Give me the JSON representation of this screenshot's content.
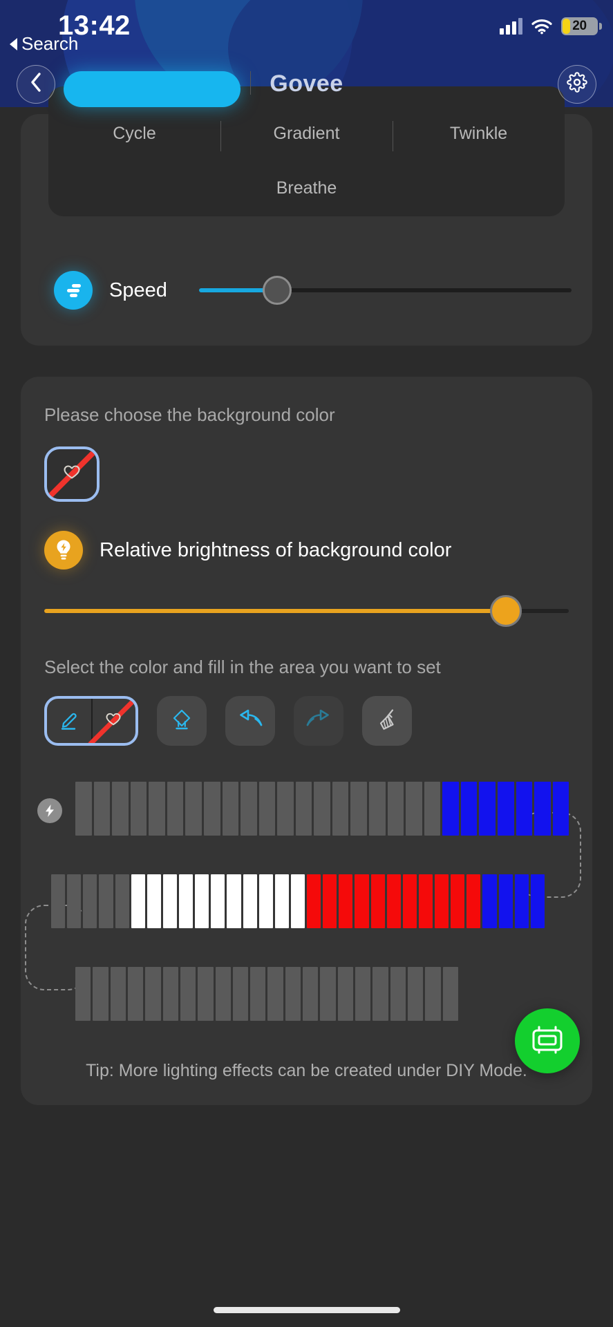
{
  "status_bar": {
    "time": "13:42",
    "back_app_label": "Search",
    "battery_percent": "20",
    "battery_level": 20,
    "signal_icon": "cellular-signal-icon",
    "wifi_icon": "wifi-icon",
    "battery_icon": "battery-icon"
  },
  "nav": {
    "back_icon": "chevron-left-icon",
    "brand_title": "Govee",
    "settings_icon": "gear-icon"
  },
  "modes": {
    "selected_index": 0,
    "items": [
      "Cycle",
      "Gradient",
      "Twinkle"
    ],
    "second_row": [
      "Breathe"
    ]
  },
  "speed": {
    "icon": "speed-icon",
    "label": "Speed",
    "value_percent": 21,
    "fill_color": "#17a8e0",
    "thumb_color": "#525252"
  },
  "background_section": {
    "choose_label": "Please choose the background color",
    "swatch": {
      "name": "no-color-swatch",
      "selected": true,
      "border_color": "#9bbdf0",
      "stripe_color": "#f0332c"
    },
    "brightness": {
      "icon": "bulb-icon",
      "label": "Relative brightness of background color",
      "value_percent": 88,
      "fill_color": "#e8a31f",
      "thumb_color": "#eda31c"
    },
    "select_label": "Select the color and fill in the area you want to set",
    "tools": [
      {
        "name": "pen-nocolor-tool",
        "icon": "pencil-icon",
        "secondary_icon": "no-color-icon",
        "selected": true,
        "enabled": true
      },
      {
        "name": "eraser-tool",
        "icon": "eraser-icon",
        "selected": false,
        "enabled": true
      },
      {
        "name": "undo-tool",
        "icon": "undo-arrow-icon",
        "selected": false,
        "enabled": true
      },
      {
        "name": "redo-tool",
        "icon": "redo-arrow-icon",
        "selected": false,
        "enabled": false
      },
      {
        "name": "clear-all-tool",
        "icon": "broom-icon",
        "selected": false,
        "enabled": true
      }
    ]
  },
  "colors": {
    "off": "#5a5a5a",
    "blue": "#1212ee",
    "red": "#f50a0a",
    "white": "#ffffff",
    "accent_cyan": "#17b6ef",
    "accent_orange": "#e8a31f",
    "accent_green": "#13cf2e",
    "card_bg": "#353535",
    "page_bg": "#2b2b2b",
    "header_bg": "#1b2a6b"
  },
  "led_strips": {
    "power_badge_icon": "lightning-bolt-icon",
    "rows": [
      {
        "name": "led-strip-row-1",
        "segments": [
          "off",
          "off",
          "off",
          "off",
          "off",
          "off",
          "off",
          "off",
          "off",
          "off",
          "off",
          "off",
          "off",
          "off",
          "off",
          "off",
          "off",
          "off",
          "off",
          "off",
          "blue",
          "blue",
          "blue",
          "blue",
          "blue",
          "blue",
          "blue"
        ]
      },
      {
        "name": "led-strip-row-2",
        "segments": [
          "off",
          "off",
          "off",
          "off",
          "off",
          "white",
          "white",
          "white",
          "white",
          "white",
          "white",
          "white",
          "white",
          "white",
          "white",
          "white",
          "red",
          "red",
          "red",
          "red",
          "red",
          "red",
          "red",
          "red",
          "red",
          "red",
          "red",
          "blue",
          "blue",
          "blue",
          "blue"
        ]
      },
      {
        "name": "led-strip-row-3",
        "segments": [
          "off",
          "off",
          "off",
          "off",
          "off",
          "off",
          "off",
          "off",
          "off",
          "off",
          "off",
          "off",
          "off",
          "off",
          "off",
          "off",
          "off",
          "off",
          "off",
          "off",
          "off",
          "off"
        ]
      }
    ]
  },
  "tip": {
    "text": "Tip: More lighting effects can be created under DIY Mode."
  },
  "fab": {
    "name": "diy-mode-button",
    "icon": "led-controller-icon",
    "color": "#13cf2e"
  }
}
